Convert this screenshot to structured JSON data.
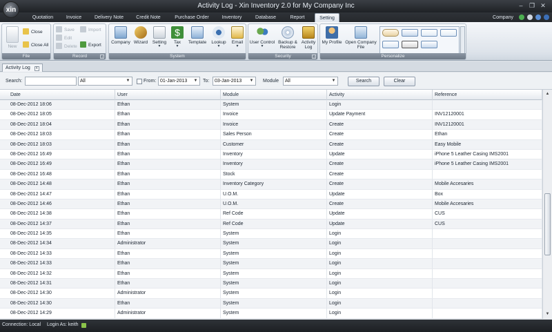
{
  "window": {
    "title": "Activity Log - Xin Inventory 2.0 for My Company Inc",
    "logo_text": "xin",
    "minimize": "–",
    "restore": "❐",
    "close": "✕"
  },
  "ribbon_tabs": [
    "Quotation",
    "Invoice",
    "Delivery Note",
    "Credit Note",
    "Purchase Order",
    "Inventory",
    "Database",
    "Report",
    "Setting"
  ],
  "active_tab": "Setting",
  "company_menu": "Company",
  "ribbon": {
    "file": {
      "label": "File",
      "new": "New",
      "close": "Close",
      "close_all": "Close All"
    },
    "record": {
      "label": "Record",
      "save": "Save",
      "edit": "Edit",
      "delete": "Delete",
      "import": "Import",
      "export": "Export"
    },
    "system": {
      "label": "System",
      "company": "Company",
      "wizard": "Wizard",
      "setting": "Setting",
      "tax": "Tax",
      "template": "Template",
      "lookup": "Lookup",
      "email": "Email"
    },
    "security": {
      "label": "Security",
      "user_control": "User Control",
      "backup": "Backup &",
      "restore": "Restore",
      "activity": "Activity",
      "log": "Log"
    },
    "personalize": {
      "label": "Personalize",
      "my_profile": "My Profile",
      "open_company": "Open Company",
      "file": "File"
    }
  },
  "doc_tab": {
    "label": "Activity Log",
    "close": "x"
  },
  "filter": {
    "search_label": "Search:",
    "search_value": "",
    "scope_value": "All",
    "from_label": "From:",
    "from_value": "01-Jan-2013",
    "to_label": "To:",
    "to_value": "03-Jan-2013",
    "module_label": "Module",
    "module_value": "All",
    "search_button": "Search",
    "clear_button": "Clear"
  },
  "grid": {
    "columns": [
      "Date",
      "User",
      "Module",
      "Activity",
      "Reference"
    ],
    "rows": [
      [
        "08-Dec-2012 18:06",
        "Ethan",
        "System",
        "Login",
        ""
      ],
      [
        "08-Dec-2012 18:05",
        "Ethan",
        "Invoice",
        "Update Payment",
        "INV12120001"
      ],
      [
        "08-Dec-2012 18:04",
        "Ethan",
        "Invoice",
        "Create",
        "INV12120001"
      ],
      [
        "08-Dec-2012 18:03",
        "Ethan",
        "Sales Person",
        "Create",
        "Ethan"
      ],
      [
        "08-Dec-2012 18:03",
        "Ethan",
        "Customer",
        "Create",
        "Easy Mobile"
      ],
      [
        "08-Dec-2012 16:49",
        "Ethan",
        "Inventory",
        "Update",
        "iPhone 5 Leather Casing IMS2001"
      ],
      [
        "08-Dec-2012 16:49",
        "Ethan",
        "Inventory",
        "Create",
        "iPhone 5 Leather Casing IMS2001"
      ],
      [
        "08-Dec-2012 16:48",
        "Ethan",
        "Stock",
        "Create",
        ""
      ],
      [
        "08-Dec-2012 14:48",
        "Ethan",
        "Inventory Category",
        "Create",
        "Mobile Accesaries"
      ],
      [
        "08-Dec-2012 14:47",
        "Ethan",
        "U.O.M.",
        "Update",
        "Box"
      ],
      [
        "08-Dec-2012 14:46",
        "Ethan",
        "U.O.M.",
        "Create",
        "Mobile Accesaries"
      ],
      [
        "08-Dec-2012 14:38",
        "Ethan",
        "Ref Code",
        "Update",
        "CUS"
      ],
      [
        "08-Dec-2012 14:37",
        "Ethan",
        "Ref Code",
        "Update",
        "CUS"
      ],
      [
        "08-Dec-2012 14:35",
        "Ethan",
        "System",
        "Login",
        ""
      ],
      [
        "08-Dec-2012 14:34",
        "Administrator",
        "System",
        "Login",
        ""
      ],
      [
        "08-Dec-2012 14:33",
        "Ethan",
        "System",
        "Login",
        ""
      ],
      [
        "08-Dec-2012 14:33",
        "Ethan",
        "System",
        "Login",
        ""
      ],
      [
        "08-Dec-2012 14:32",
        "Ethan",
        "System",
        "Login",
        ""
      ],
      [
        "08-Dec-2012 14:31",
        "Ethan",
        "System",
        "Login",
        ""
      ],
      [
        "08-Dec-2012 14:30",
        "Administrator",
        "System",
        "Login",
        ""
      ],
      [
        "08-Dec-2012 14:30",
        "Ethan",
        "System",
        "Login",
        ""
      ],
      [
        "08-Dec-2012 14:29",
        "Administrator",
        "System",
        "Login",
        ""
      ]
    ]
  },
  "status": {
    "connection": "Connection: Local",
    "login": "Login As: keith"
  },
  "colors": {
    "chrome_dark": "#25282c",
    "ribbon_light": "#e2e8ef",
    "accent_blue": "#6c8fb8"
  }
}
